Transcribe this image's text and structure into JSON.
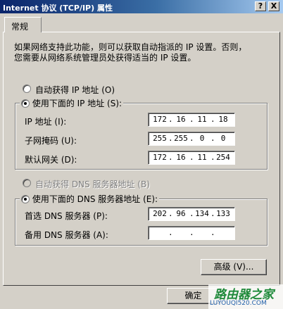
{
  "window": {
    "title": "Internet 协议 (TCP/IP) 属性",
    "help_button": "?",
    "close_button": "X"
  },
  "tabs": [
    {
      "label": "常规",
      "selected": true
    }
  ],
  "description": [
    "如果网络支持此功能，则可以获取自动指派的 IP 设置。否则，",
    "您需要从网络系统管理员处获得适当的 IP 设置。"
  ],
  "ip_section": {
    "auto_radio": "自动获得 IP 地址 (O)",
    "manual_radio": "使用下面的 IP 地址 (S):",
    "selected": "manual",
    "fields": [
      {
        "label": "IP 地址 (I):",
        "octets": [
          "172",
          "16",
          "11",
          "18"
        ]
      },
      {
        "label": "子网掩码 (U):",
        "octets": [
          "255",
          "255",
          "0",
          "0"
        ]
      },
      {
        "label": "默认网关 (D):",
        "octets": [
          "172",
          "16",
          "11",
          "254"
        ]
      }
    ]
  },
  "dns_section": {
    "auto_radio": "自动获得 DNS 服务器地址 (B)",
    "manual_radio": "使用下面的 DNS 服务器地址 (E):",
    "selected": "manual",
    "fields": [
      {
        "label": "首选 DNS 服务器 (P):",
        "octets": [
          "202",
          "96",
          "134",
          "133"
        ]
      },
      {
        "label": "备用 DNS 服务器 (A):",
        "octets": [
          "",
          "",
          "",
          ""
        ]
      }
    ]
  },
  "buttons": {
    "advanced": "高级 (V)...",
    "ok": "确定"
  },
  "watermark": {
    "main": "路由器之家",
    "sub": "LUYOUQI520.COM"
  }
}
